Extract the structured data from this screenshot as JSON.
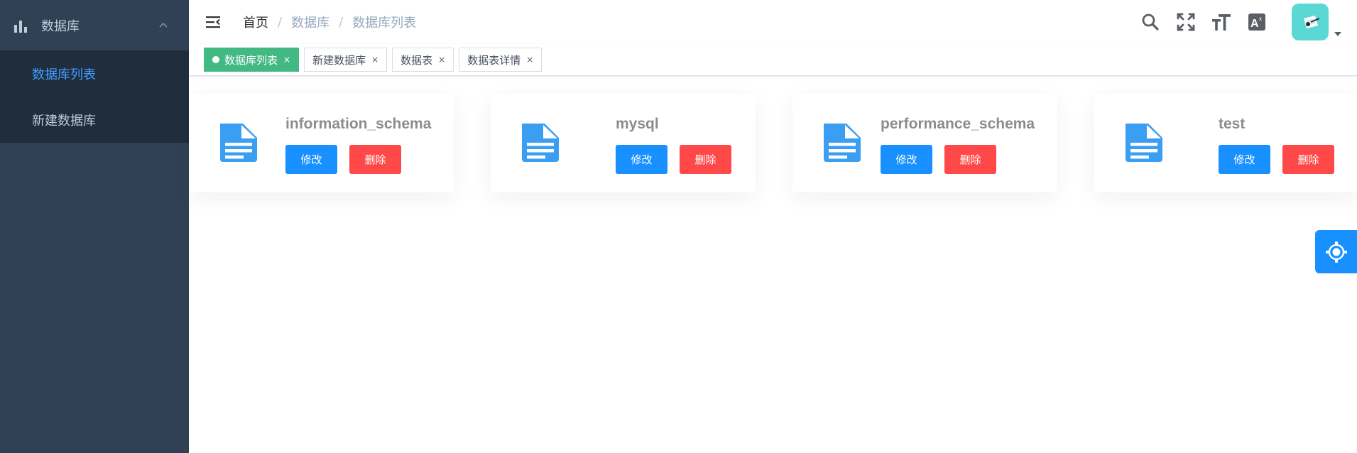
{
  "sidebar": {
    "group_label": "数据库",
    "items": [
      {
        "label": "数据库列表",
        "active": true
      },
      {
        "label": "新建数据库",
        "active": false
      }
    ]
  },
  "navbar": {
    "breadcrumb": [
      "首页",
      "数据库",
      "数据库列表"
    ],
    "icons": [
      "search-icon",
      "fullscreen-icon",
      "text-size-icon",
      "translate-icon"
    ]
  },
  "tags": [
    {
      "label": "数据库列表",
      "active": true
    },
    {
      "label": "新建数据库",
      "active": false
    },
    {
      "label": "数据表",
      "active": false
    },
    {
      "label": "数据表详情",
      "active": false
    }
  ],
  "tag_close_glyph": "×",
  "databases": [
    {
      "name": "information_schema",
      "edit_label": "修改",
      "delete_label": "删除"
    },
    {
      "name": "mysql",
      "edit_label": "修改",
      "delete_label": "删除"
    },
    {
      "name": "performance_schema",
      "edit_label": "修改",
      "delete_label": "删除"
    },
    {
      "name": "test",
      "edit_label": "修改",
      "delete_label": "删除"
    }
  ],
  "colors": {
    "sidebar_bg": "#304156",
    "sidebar_sub_bg": "#1f2d3d",
    "active_menu": "#409eff",
    "active_tag": "#42b983",
    "edit_button": "#1890ff",
    "delete_button": "#ff4949",
    "doc_icon": "#3a9ff2",
    "avatar_bg": "#5bd8d3"
  }
}
